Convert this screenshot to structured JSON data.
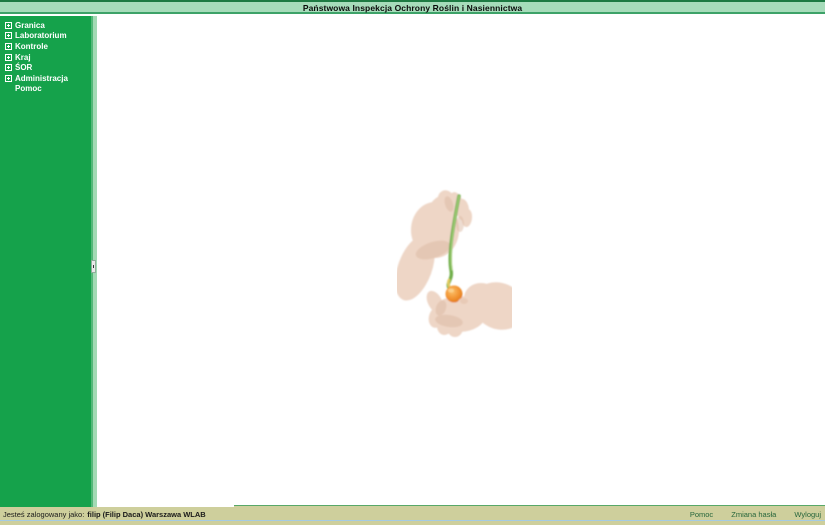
{
  "header": {
    "title": "Państwowa Inspekcja Ochrony Roślin i Nasiennictwa"
  },
  "sidebar": {
    "items": [
      {
        "label": "Granica",
        "expandable": true
      },
      {
        "label": "Laboratorium",
        "expandable": true
      },
      {
        "label": "Kontrole",
        "expandable": true
      },
      {
        "label": "Kraj",
        "expandable": true
      },
      {
        "label": "ŚOR",
        "expandable": true
      },
      {
        "label": "Administracja",
        "expandable": true
      },
      {
        "label": "Pomoc",
        "expandable": false
      }
    ]
  },
  "main": {
    "illustration": "hands-holding-seedling-with-orange-bulb"
  },
  "statusbar": {
    "login_prefix": "Jesteś zalogowany jako:",
    "login_user": "filip",
    "login_details": "(Filip Daca) Warszawa WLAB",
    "links": [
      {
        "label": "Pomoc"
      },
      {
        "label": "Zmiana hasła"
      },
      {
        "label": "Wyloguj"
      }
    ]
  },
  "colors": {
    "top_border": "#1c7a42",
    "header_bg": "#a6dcba",
    "header_border": "#3da268",
    "sidebar_bg": "#15a24b",
    "splitter_light": "#a2dab4",
    "statusbar_bg": "#cecf9c",
    "statusbar_edge_green": "#58a868",
    "statusbar_line_blue": "#a4cbe4",
    "link_color": "#27663c",
    "stem_green": "#6fae49",
    "bulb_orange": "#f29432"
  }
}
